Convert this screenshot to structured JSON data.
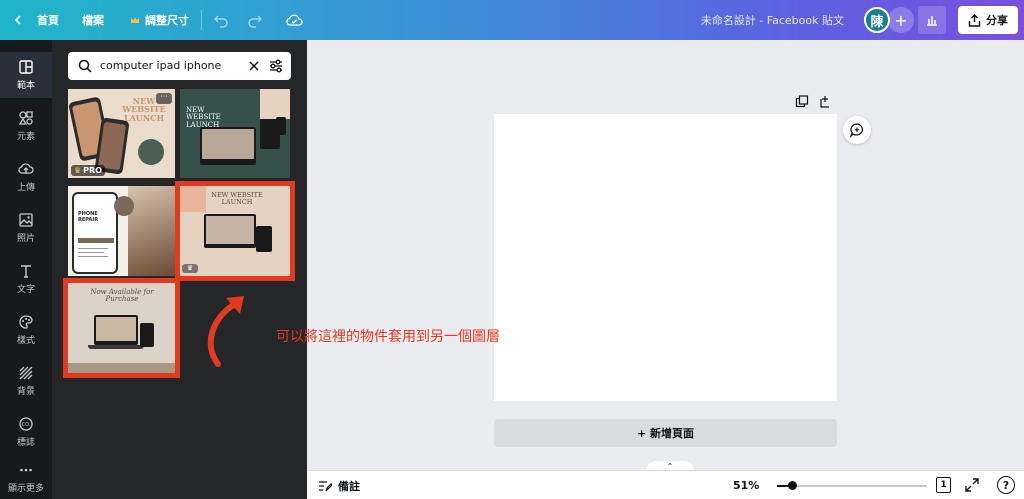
{
  "topbar": {
    "home_label": "首頁",
    "file_label": "檔案",
    "resize_label": "調整尺寸",
    "design_title": "未命名設計 - Facebook 貼文",
    "avatar_initial": "陳",
    "share_label": "分享"
  },
  "rail": {
    "items": [
      {
        "label": "範本",
        "icon": "template-icon"
      },
      {
        "label": "元素",
        "icon": "elements-icon"
      },
      {
        "label": "上傳",
        "icon": "upload-icon"
      },
      {
        "label": "照片",
        "icon": "photo-icon"
      },
      {
        "label": "文字",
        "icon": "text-icon"
      },
      {
        "label": "樣式",
        "icon": "palette-icon"
      },
      {
        "label": "背景",
        "icon": "background-icon"
      },
      {
        "label": "標誌",
        "icon": "logo-icon"
      },
      {
        "label": "顯示更多",
        "icon": "more-icon"
      }
    ]
  },
  "panel": {
    "search_value": "computer ipad iphone",
    "templates": [
      {
        "title": "NEW WEBSITE LAUNCH",
        "badge": "PRO"
      },
      {
        "title": "NEW WEBSITE LAUNCH"
      },
      {
        "title": "PHONE REPAIR"
      },
      {
        "title": "NEW WEBSITE LAUNCH"
      },
      {
        "title": "Now Available for Purchase"
      }
    ]
  },
  "canvas": {
    "add_page_label": "+ 新增頁面",
    "annotation": "可以將這裡的物件套用到另一個圖層"
  },
  "bottombar": {
    "notes_label": "備註",
    "zoom_label": "51%",
    "zoom_value": 0.1,
    "page_count": "1",
    "help_label": "?"
  },
  "colors": {
    "accent_red": "#e23a1f",
    "gradient_start": "#1fb6c9",
    "gradient_end": "#7a4fe0"
  }
}
